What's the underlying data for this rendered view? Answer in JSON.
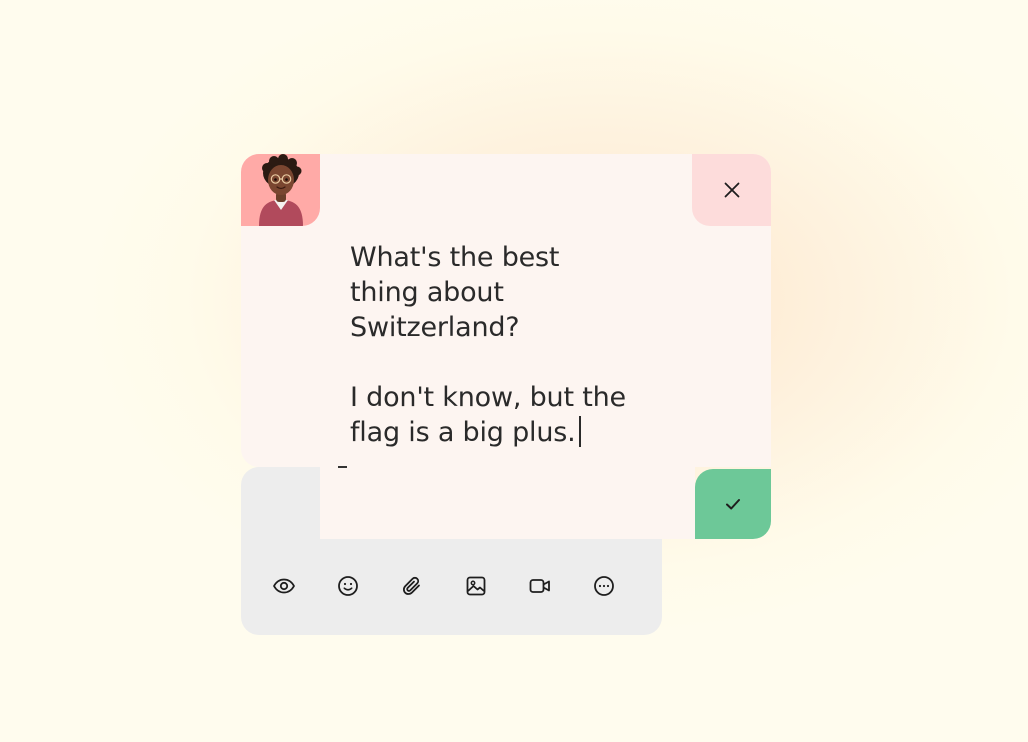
{
  "composer": {
    "message_line1": "What's the best",
    "message_line2": "thing about",
    "message_line3": "Switzerland?",
    "message_line4": "",
    "message_line5": "I don't know, but the",
    "message_line6": "flag is a big plus."
  },
  "icons": {
    "close": "close-icon",
    "confirm": "check-icon",
    "preview": "eye-icon",
    "emoji": "smile-icon",
    "attach": "paperclip-icon",
    "image": "image-icon",
    "video": "video-icon",
    "more": "more-icon"
  },
  "colors": {
    "note_background": "#fdf5f1",
    "avatar_tile": "#ffaaa7",
    "close_tile": "#fddcdb",
    "confirm_tile": "#6dc898",
    "toolbar": "#ededed",
    "text": "#2a2a2a"
  }
}
